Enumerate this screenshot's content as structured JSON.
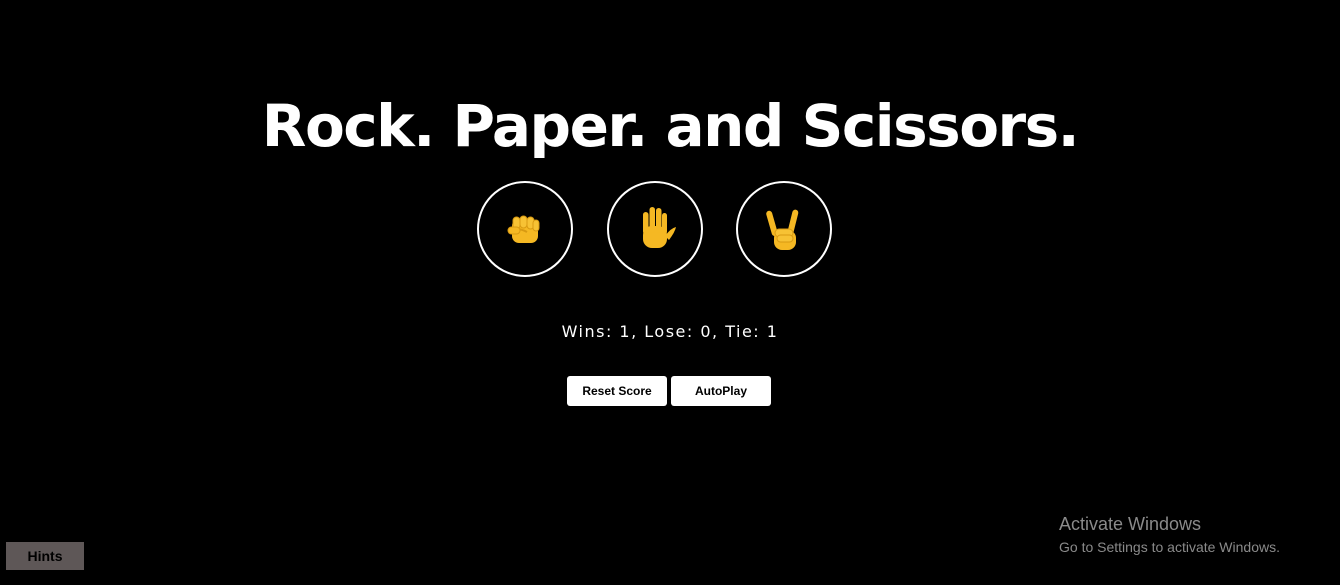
{
  "title": "Rock. Paper. and Scissors.",
  "moves": [
    {
      "name": "rock",
      "icon": "rock-fist-icon"
    },
    {
      "name": "paper",
      "icon": "raised-hand-icon"
    },
    {
      "name": "scissors",
      "icon": "victory-hand-icon"
    }
  ],
  "score": {
    "text": "Wins: 1, Lose: 0, Tie: 1"
  },
  "buttons": {
    "reset_label": "Reset Score",
    "autoplay_label": "AutoPlay"
  },
  "hints_label": "Hints",
  "watermark": {
    "line1": "Activate Windows",
    "line2": "Go to Settings to activate Windows."
  },
  "colors": {
    "background": "#000000",
    "foreground": "#ffffff",
    "emoji": "#f5b823",
    "hints_bg": "#5e5757",
    "watermark": "#8a8a8a"
  }
}
